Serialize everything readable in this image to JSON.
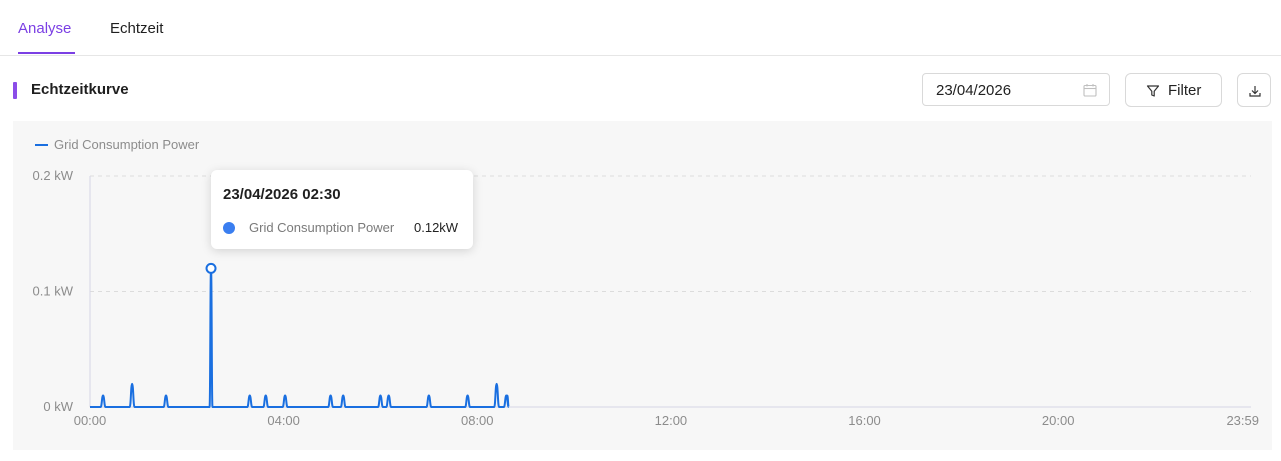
{
  "tabs": [
    {
      "label": "Analyse",
      "active": true
    },
    {
      "label": "Echtzeit",
      "active": false
    }
  ],
  "section": {
    "title": "Echtzeitkurve"
  },
  "toolbar": {
    "date_value": "23/04/2026",
    "filter_label": "Filter",
    "icons": {
      "calendar": "calendar-icon",
      "filter": "funnel-icon",
      "download": "download-icon"
    }
  },
  "colors": {
    "accent": "#7b3fe4",
    "series": "#1a6fe0",
    "tooltip_dot": "#3a7ef0"
  },
  "tooltip": {
    "title": "23/04/2026 02:30",
    "series_name": "Grid Consumption Power",
    "value": "0.12kW"
  },
  "chart_data": {
    "type": "line",
    "legend_placement": "top-left",
    "grid": true,
    "x_unit": "hours",
    "xlim": [
      0,
      23.9833
    ],
    "xticks": [
      {
        "x": 0,
        "label": "00:00"
      },
      {
        "x": 4,
        "label": "04:00"
      },
      {
        "x": 8,
        "label": "08:00"
      },
      {
        "x": 12,
        "label": "12:00"
      },
      {
        "x": 16,
        "label": "16:00"
      },
      {
        "x": 20,
        "label": "20:00"
      },
      {
        "x": 23.9833,
        "label": "23:59"
      }
    ],
    "ylim": [
      0,
      0.2
    ],
    "yticks": [
      {
        "y": 0,
        "label": "0 kW"
      },
      {
        "y": 0.1,
        "label": "0.1 kW"
      },
      {
        "y": 0.2,
        "label": "0.2 kW"
      }
    ],
    "series": [
      {
        "name": "Grid Consumption Power",
        "spikes": [
          {
            "x": 0.27,
            "y": 0.01
          },
          {
            "x": 0.87,
            "y": 0.02
          },
          {
            "x": 1.57,
            "y": 0.01
          },
          {
            "x": 2.5,
            "y": 0.12
          },
          {
            "x": 3.3,
            "y": 0.01
          },
          {
            "x": 3.63,
            "y": 0.01
          },
          {
            "x": 4.03,
            "y": 0.01
          },
          {
            "x": 4.97,
            "y": 0.01
          },
          {
            "x": 5.23,
            "y": 0.01
          },
          {
            "x": 6.0,
            "y": 0.01
          },
          {
            "x": 6.17,
            "y": 0.01
          },
          {
            "x": 7.0,
            "y": 0.01
          },
          {
            "x": 7.8,
            "y": 0.01
          },
          {
            "x": 8.4,
            "y": 0.02
          },
          {
            "x": 8.6,
            "y": 0.01
          }
        ],
        "highlight": {
          "x": 2.5,
          "y": 0.12
        }
      }
    ]
  }
}
